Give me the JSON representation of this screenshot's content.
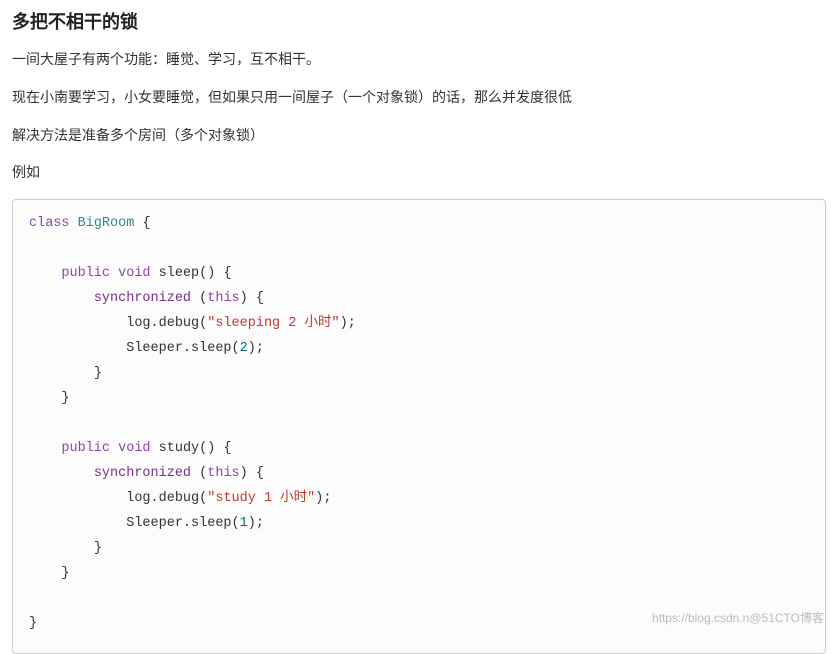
{
  "title": "多把不相干的锁",
  "paragraphs": [
    "一间大屋子有两个功能：睡觉、学习，互不相干。",
    "现在小南要学习，小女要睡觉，但如果只用一间屋子（一个对象锁）的话，那么并发度很低",
    "解决方法是准备多个房间（多个对象锁）",
    "例如"
  ],
  "code": {
    "class_kw": "class",
    "class_name": "BigRoom",
    "public_kw": "public",
    "void_kw": "void",
    "sync_kw": "synchronized",
    "this_kw": "this",
    "method_sleep": "sleep",
    "method_study": "study",
    "log_call": "log.debug",
    "sleeper_call": "Sleeper.sleep",
    "str_sleep": "\"sleeping 2 小时\"",
    "str_study": "\"study 1 小时\"",
    "num_2": "2",
    "num_1": "1",
    "brace_open": "{",
    "brace_close": "}",
    "paren_open": "(",
    "paren_close": ")",
    "semi": ";",
    "empty_parens": "()"
  },
  "watermark": "https://blog.csdn.n@51CTO博客"
}
